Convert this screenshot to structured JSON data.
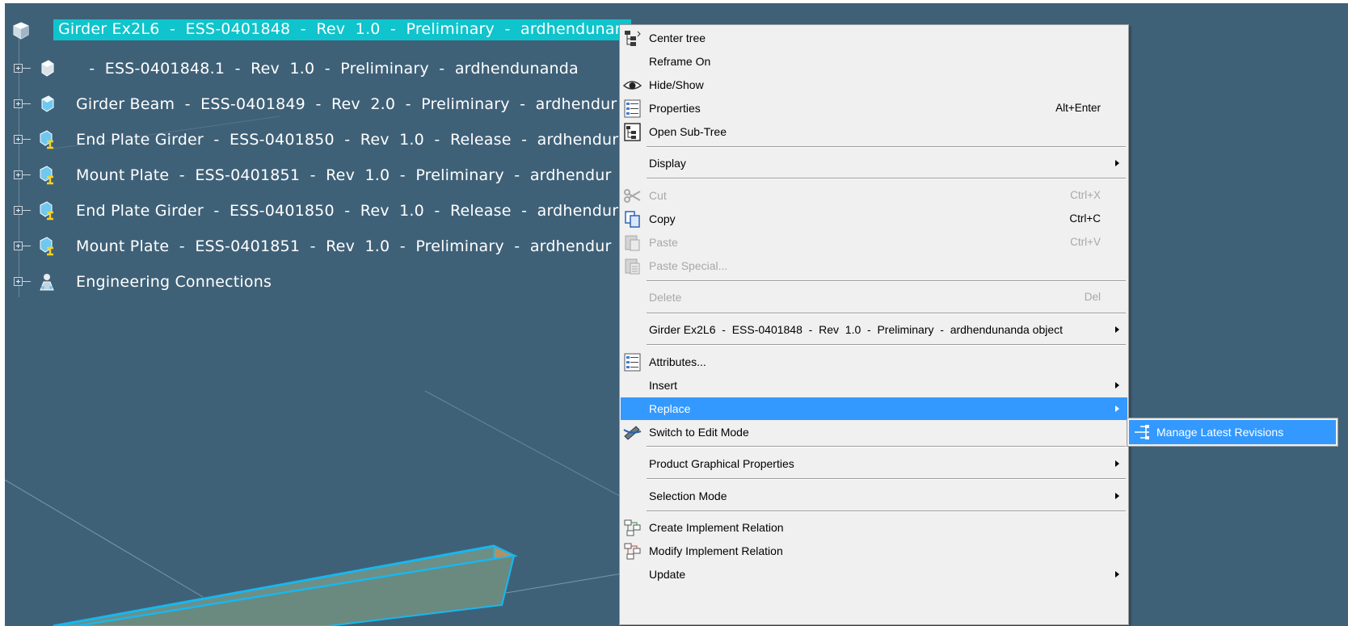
{
  "tree": {
    "root": {
      "label": "Girder Ex2L6  -  ESS-0401848  -  Rev  1.0  -  Preliminary  -  ardhendunan",
      "icon": "product-root-icon"
    },
    "nodes": [
      {
        "label": " -  ESS-0401848.1  -  Rev  1.0  -  Preliminary  -  ardhendunanda",
        "icon": "part-icon"
      },
      {
        "label": "Girder Beam  -  ESS-0401849  -  Rev  2.0  -  Preliminary  -  ardhendur",
        "icon": "part-icon"
      },
      {
        "label": "End Plate Girder  -  ESS-0401850  -  Rev  1.0  -  Release  -  ardhendur",
        "icon": "part-reference-icon"
      },
      {
        "label": "Mount Plate  -  ESS-0401851  -  Rev  1.0  -  Preliminary  -  ardhendur",
        "icon": "part-reference-icon"
      },
      {
        "label": "End Plate Girder  -  ESS-0401850  -  Rev  1.0  -  Release  -  ardhendur",
        "icon": "part-reference-icon"
      },
      {
        "label": "Mount Plate  -  ESS-0401851  -  Rev  1.0  -  Preliminary  -  ardhendur",
        "icon": "part-reference-icon"
      },
      {
        "label": "Engineering Connections",
        "icon": "engineering-connections-icon"
      }
    ]
  },
  "menu": {
    "center_tree": "Center tree",
    "reframe_on": "Reframe On",
    "hide_show": "Hide/Show",
    "properties": "Properties",
    "properties_shortcut": "Alt+Enter",
    "open_sub_tree": "Open Sub-Tree",
    "display": "Display",
    "cut": "Cut",
    "cut_shortcut": "Ctrl+X",
    "copy": "Copy",
    "copy_shortcut": "Ctrl+C",
    "paste": "Paste",
    "paste_shortcut": "Ctrl+V",
    "paste_special": "Paste Special...",
    "delete": "Delete",
    "delete_shortcut": "Del",
    "object": "Girder Ex2L6  -  ESS-0401848  -  Rev  1.0  -  Preliminary  -  ardhendunanda object",
    "attributes": "Attributes...",
    "insert": "Insert",
    "replace": "Replace",
    "switch_edit_mode": "Switch to Edit Mode",
    "product_graphical_properties": "Product Graphical Properties",
    "selection_mode": "Selection Mode",
    "create_implement_relation": "Create Implement Relation",
    "modify_implement_relation": "Modify Implement Relation",
    "update": "Update"
  },
  "submenu": {
    "manage_latest_revisions": "Manage Latest Revisions"
  },
  "colors": {
    "viewport_bg": "#3f6178",
    "tree_selection": "#0fc4cc",
    "menu_highlight": "#3399ff",
    "beam_edge": "#16b8f0"
  }
}
